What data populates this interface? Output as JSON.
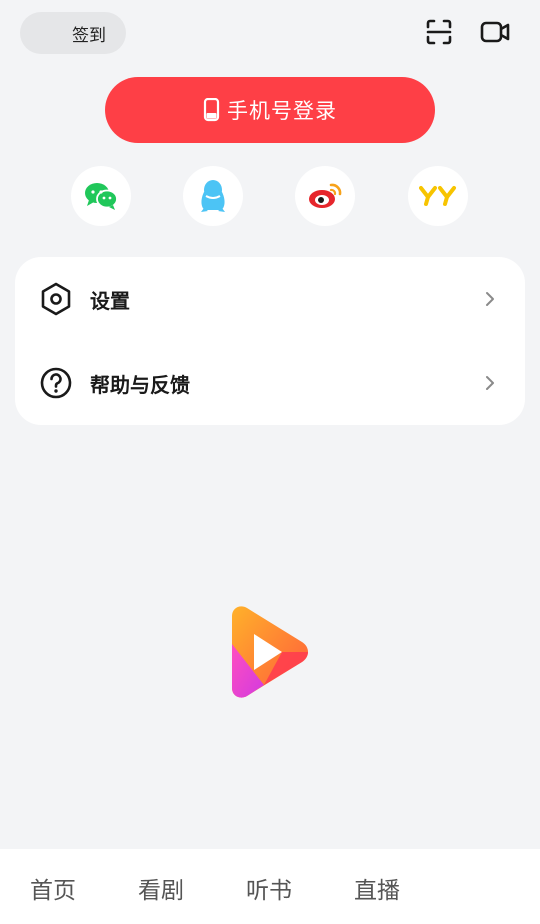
{
  "header": {
    "checkin_label": "签到",
    "scan_icon": "scan-icon",
    "video_icon": "video-icon"
  },
  "login": {
    "label": "手机号登录",
    "icon": "phone-icon",
    "color": "#fe3f46"
  },
  "social_logins": [
    {
      "name": "wechat",
      "icon": "wechat-icon",
      "color": "#20c75a"
    },
    {
      "name": "qq",
      "icon": "qq-icon",
      "color": "#4cc4f5"
    },
    {
      "name": "weibo",
      "icon": "weibo-icon",
      "color": "#e6262c"
    },
    {
      "name": "yy",
      "icon": "yy-icon",
      "color": "#f7c400"
    }
  ],
  "menu": {
    "items": [
      {
        "label": "设置",
        "icon": "settings-hexagon-icon"
      },
      {
        "label": "帮助与反馈",
        "icon": "help-question-icon"
      }
    ]
  },
  "tabs": [
    {
      "label": "首页"
    },
    {
      "label": "看剧"
    },
    {
      "label": "听书"
    },
    {
      "label": "直播"
    }
  ],
  "colors": {
    "background": "#f3f4f6",
    "card": "#ffffff",
    "accent": "#fe3f46"
  }
}
